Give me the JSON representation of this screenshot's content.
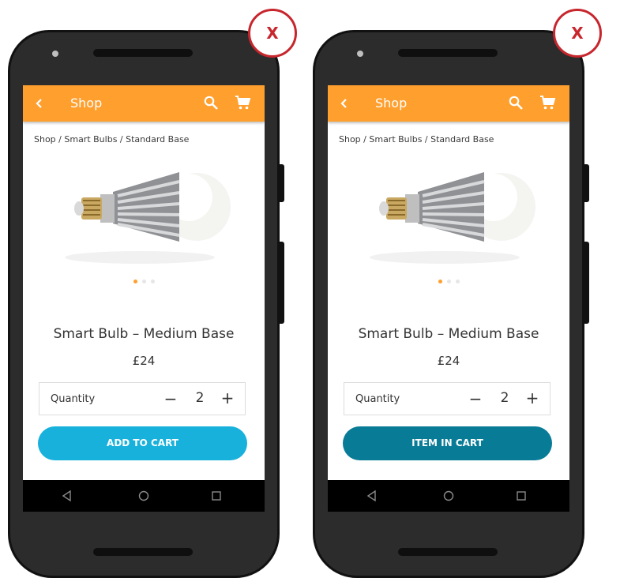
{
  "accent_color": "#ff9f2e",
  "screens": [
    {
      "appbar": {
        "title": "Shop",
        "back_icon": "chevron-left-icon",
        "search_icon": "search-icon",
        "cart_icon": "shopping-cart-icon"
      },
      "breadcrumb": "Shop / Smart Bulbs / Standard Base",
      "product": {
        "name": "Smart Bulb – Medium Base",
        "price": "£24",
        "image_icon": "light-bulb-image",
        "carousel_pages": 3,
        "carousel_active": 1
      },
      "quantity": {
        "label": "Quantity",
        "minus": "−",
        "value": "2",
        "plus": "+"
      },
      "cta": {
        "label": "ADD TO CART",
        "color": "#17b1dc"
      },
      "close_label": "X"
    },
    {
      "appbar": {
        "title": "Shop",
        "back_icon": "chevron-left-icon",
        "search_icon": "search-icon",
        "cart_icon": "shopping-cart-icon"
      },
      "breadcrumb": "Shop / Smart Bulbs / Standard Base",
      "product": {
        "name": "Smart Bulb – Medium Base",
        "price": "£24",
        "image_icon": "light-bulb-image",
        "carousel_pages": 3,
        "carousel_active": 1
      },
      "quantity": {
        "label": "Quantity",
        "minus": "−",
        "value": "2",
        "plus": "+"
      },
      "cta": {
        "label": "ITEM IN CART",
        "color": "#087b97"
      },
      "close_label": "X"
    }
  ],
  "nav_icons": [
    "back-triangle-icon",
    "home-circle-icon",
    "recents-square-icon"
  ]
}
